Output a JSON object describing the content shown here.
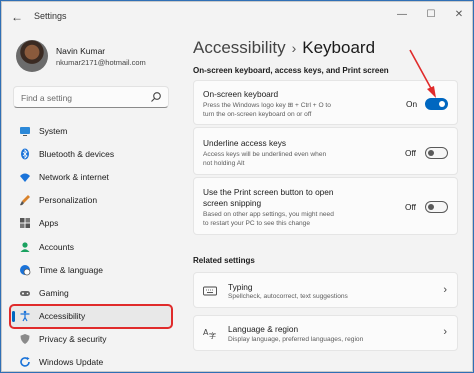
{
  "window": {
    "title": "Settings",
    "back_icon": "arrow-left-icon",
    "min_icon": "minimize-icon",
    "max_icon": "maximize-icon",
    "close_icon": "close-icon"
  },
  "user": {
    "name": "Navin Kumar",
    "email": "nkumar2171@hotmail.com"
  },
  "search": {
    "placeholder": "Find a setting"
  },
  "sidebar": {
    "items": [
      {
        "label": "System",
        "icon": "monitor-icon"
      },
      {
        "label": "Bluetooth & devices",
        "icon": "bluetooth-icon"
      },
      {
        "label": "Network & internet",
        "icon": "wifi-icon"
      },
      {
        "label": "Personalization",
        "icon": "brush-icon"
      },
      {
        "label": "Apps",
        "icon": "apps-icon"
      },
      {
        "label": "Accounts",
        "icon": "person-icon"
      },
      {
        "label": "Time & language",
        "icon": "globe-clock-icon"
      },
      {
        "label": "Gaming",
        "icon": "gamepad-icon"
      },
      {
        "label": "Accessibility",
        "icon": "accessibility-icon",
        "active": true
      },
      {
        "label": "Privacy & security",
        "icon": "shield-icon"
      },
      {
        "label": "Windows Update",
        "icon": "update-icon"
      }
    ]
  },
  "breadcrumb": {
    "parent": "Accessibility",
    "separator": "›",
    "current": "Keyboard"
  },
  "section": {
    "title": "On-screen keyboard, access keys, and Print screen"
  },
  "settings": [
    {
      "title": "On-screen keyboard",
      "desc1": "Press the Windows logo key ⊞ + Ctrl + O to",
      "desc2": "turn the on-screen keyboard on or off",
      "state": "On",
      "on": true
    },
    {
      "title": "Underline access keys",
      "desc1": "Access keys will be underlined even when",
      "desc2": "not holding Alt",
      "state": "Off",
      "on": false
    },
    {
      "title1": "Use the Print screen button to open",
      "title2": "screen snipping",
      "desc1": "Based on other app settings, you might need",
      "desc2": "to restart your PC to see this change",
      "state": "Off",
      "on": false
    }
  ],
  "related": {
    "title": "Related settings",
    "items": [
      {
        "title": "Typing",
        "desc": "Spellcheck, autocorrect, text suggestions",
        "icon": "keyboard-icon"
      },
      {
        "title": "Language & region",
        "desc": "Display language, preferred languages, region",
        "icon": "language-icon"
      }
    ]
  },
  "colors": {
    "accent": "#0067c0",
    "highlight_box": "#e02b2b",
    "annotation_arrow": "#e02b2b"
  }
}
